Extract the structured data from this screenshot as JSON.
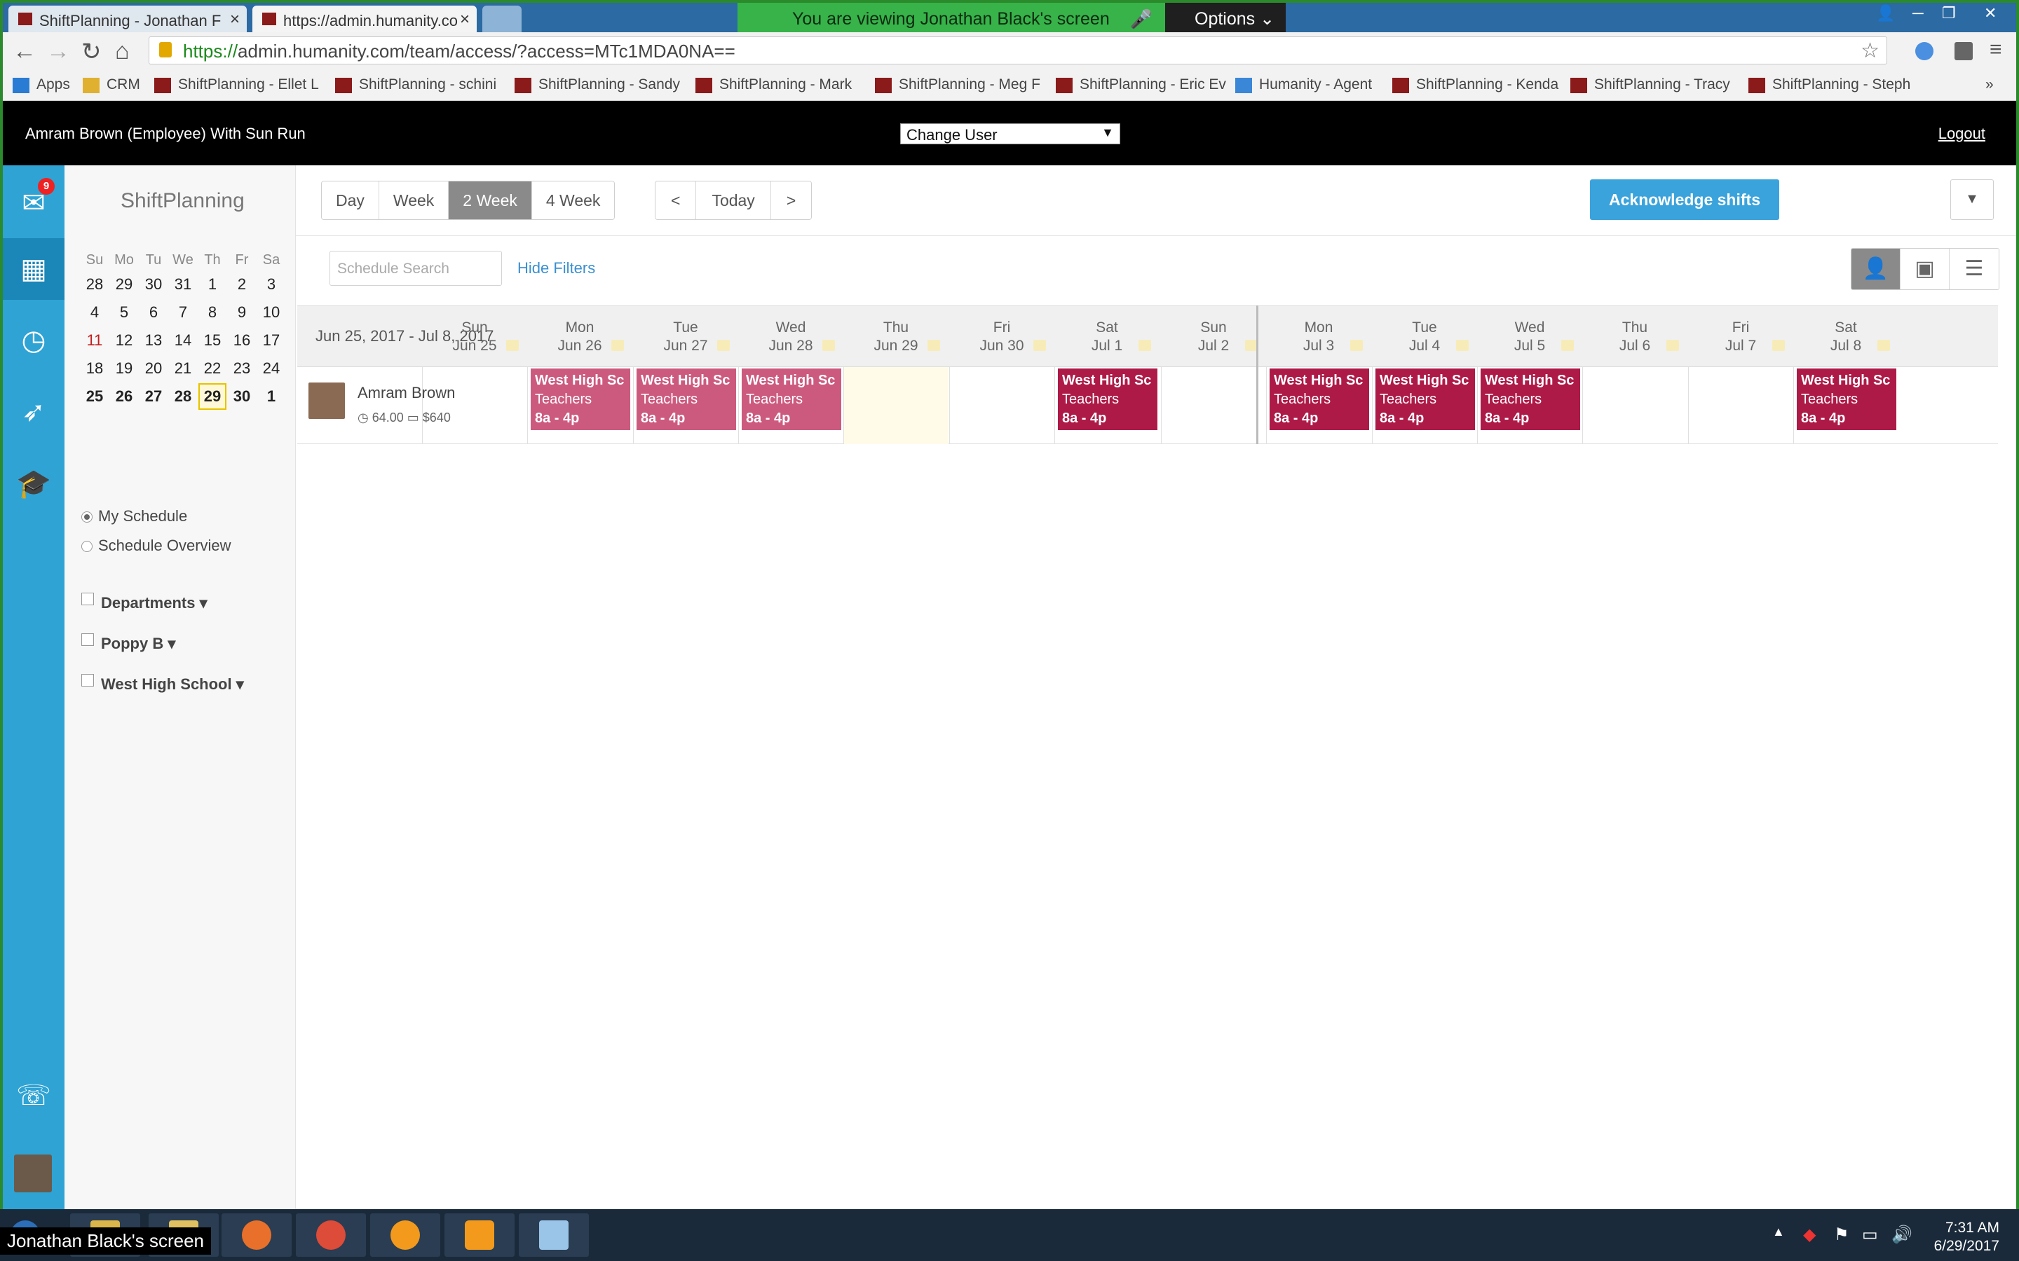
{
  "browser": {
    "tabs": [
      {
        "title": "ShiftPlanning - Jonathan F"
      },
      {
        "title": "https://admin.humanity.co"
      }
    ],
    "url_scheme": "https://",
    "url_rest": "admin.humanity.com/team/access/?access=MTc1MDA0NA==",
    "bookmarks": [
      "Apps",
      "CRM",
      "ShiftPlanning - Ellet L",
      "ShiftPlanning - schini",
      "ShiftPlanning - Sandy",
      "ShiftPlanning - Mark",
      "ShiftPlanning - Meg F",
      "ShiftPlanning - Eric Ev",
      "Humanity - Agent",
      "ShiftPlanning - Kenda",
      "ShiftPlanning - Tracy",
      "ShiftPlanning - Steph"
    ],
    "share_banner": "You are viewing Jonathan Black's screen",
    "options_label": "Options"
  },
  "adminbar": {
    "user_text": "Amram Brown (Employee)  With  Sun Run",
    "change_user": "Change User",
    "logout": "Logout"
  },
  "sidebar": {
    "badge_count": "9",
    "brand": "ShiftPlanning",
    "calendar_days": [
      "Su",
      "Mo",
      "Tu",
      "We",
      "Th",
      "Fr",
      "Sa"
    ],
    "calendar_weeks": [
      [
        "28",
        "29",
        "30",
        "31",
        "1",
        "2",
        "3"
      ],
      [
        "4",
        "5",
        "6",
        "7",
        "8",
        "9",
        "10"
      ],
      [
        "11",
        "12",
        "13",
        "14",
        "15",
        "16",
        "17"
      ],
      [
        "18",
        "19",
        "20",
        "21",
        "22",
        "23",
        "24"
      ],
      [
        "25",
        "26",
        "27",
        "28",
        "29",
        "30",
        "1"
      ]
    ],
    "my_schedule": "My Schedule",
    "schedule_overview": "Schedule Overview",
    "filters": [
      "Departments",
      "Poppy B",
      "West High School"
    ]
  },
  "controls": {
    "views": [
      "Day",
      "Week",
      "2 Week",
      "4 Week"
    ],
    "active_view": "2 Week",
    "prev": "<",
    "today": "Today",
    "next": ">",
    "acknowledge": "Acknowledge shifts",
    "search_placeholder": "Schedule Search",
    "hide_filters": "Hide Filters"
  },
  "schedule": {
    "range": "Jun 25, 2017 - Jul 8, 2017",
    "days": [
      {
        "dow": "Sun",
        "date": "Jun 25"
      },
      {
        "dow": "Mon",
        "date": "Jun 26"
      },
      {
        "dow": "Tue",
        "date": "Jun 27"
      },
      {
        "dow": "Wed",
        "date": "Jun 28"
      },
      {
        "dow": "Thu",
        "date": "Jun 29"
      },
      {
        "dow": "Fri",
        "date": "Jun 30"
      },
      {
        "dow": "Sat",
        "date": "Jul 1"
      },
      {
        "dow": "Sun",
        "date": "Jul 2"
      },
      {
        "dow": "Mon",
        "date": "Jul 3"
      },
      {
        "dow": "Tue",
        "date": "Jul 4"
      },
      {
        "dow": "Wed",
        "date": "Jul 5"
      },
      {
        "dow": "Thu",
        "date": "Jul 6"
      },
      {
        "dow": "Fri",
        "date": "Jul 7"
      },
      {
        "dow": "Sat",
        "date": "Jul 8"
      }
    ],
    "employee": {
      "name": "Amram Brown",
      "hours": "64.00",
      "cost": "$640"
    },
    "shift_title": "West High Sc",
    "shift_role": "Teachers",
    "shift_time": "8a - 4p"
  },
  "taskbar": {
    "share_label": "Jonathan Black's screen",
    "time": "7:31 AM",
    "date": "6/29/2017"
  },
  "colors": {
    "accent": "#3aa3dc",
    "shift_past": "#cc5a7f",
    "shift_future": "#ad1a48",
    "share_green": "#37b34a"
  }
}
